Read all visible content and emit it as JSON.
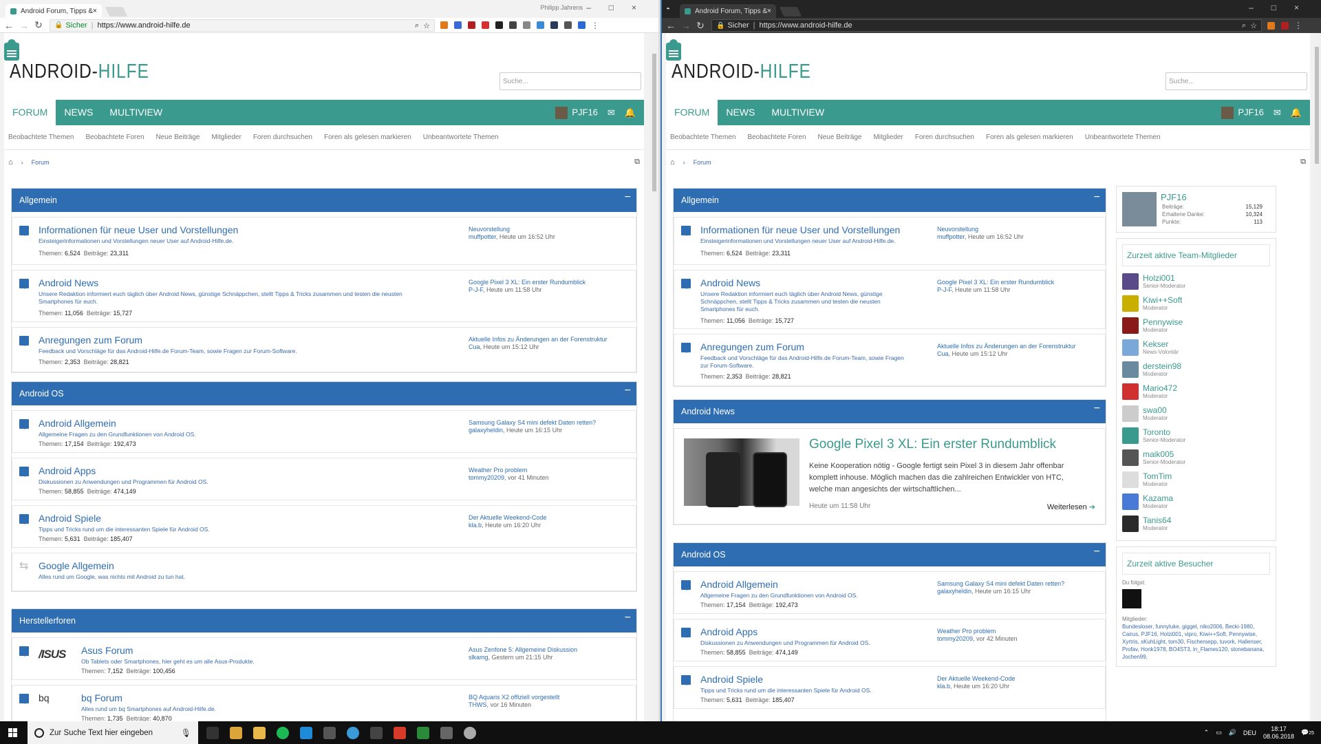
{
  "browser": {
    "tab_title": "Android Forum, Tipps &",
    "url": "https://www.android-hilfe.de",
    "secure_label": "Sicher",
    "profile_name": "Philipp Jahrens"
  },
  "site": {
    "logo_part1": "ANDROID-",
    "logo_part2": "HILFE",
    "search_placeholder": "Suche...",
    "nav": [
      "FORUM",
      "NEWS",
      "MULTIVIEW"
    ],
    "username": "PJF16",
    "subnav": [
      "Beobachtete Themen",
      "Beobachtete Foren",
      "Neue Beiträge",
      "Mitglieder",
      "Foren durchsuchen",
      "Foren als gelesen markieren",
      "Unbeantwortete Themen"
    ],
    "breadcrumb": "Forum"
  },
  "labels": {
    "threads": "Themen:",
    "posts": "Beiträge:",
    "collapse": "−"
  },
  "categories": {
    "allgemein": {
      "title": "Allgemein",
      "nodes": [
        {
          "title": "Informationen für neue User und Vorstellungen",
          "desc": "Einsteigerinformationen und Vorstellungen neuer User auf Android-Hilfe.de.",
          "threads": "6,524",
          "posts": "23,311",
          "last_title": "Neuvorstellung",
          "last_user": "muffpotter",
          "last_time": ", Heute um 16:52 Uhr"
        },
        {
          "title": "Android News",
          "desc": "Unsere Redaktion informiert euch täglich über Android News, günstige Schnäppchen, stellt Tipps & Tricks zusammen und testen die neusten Smartphones für euch.",
          "threads": "11,056",
          "posts": "15,727",
          "last_title": "Google Pixel 3 XL: Ein erster Rundumblick",
          "last_user": "P-J-F",
          "last_time": ", Heute um 11:58 Uhr"
        },
        {
          "title": "Anregungen zum Forum",
          "desc": "Feedback und Vorschläge für das Android-Hilfe.de Forum-Team, sowie Fragen zur Forum-Software.",
          "threads": "2,353",
          "posts": "28,821",
          "last_title": "Aktuelle Infos zu Änderungen an der Forenstruktur",
          "last_user": "Cua",
          "last_time": ", Heute um 15:12 Uhr"
        }
      ]
    },
    "android_os": {
      "title": "Android OS",
      "nodes": [
        {
          "title": "Android Allgemein",
          "desc": "Allgemeine Fragen zu den Grundfunktionen von Android OS.",
          "threads": "17,154",
          "posts": "192,473",
          "last_title": "Samsung Galaxy S4 mini defekt Daten retten?",
          "last_user": "galaxyheldin",
          "last_time": ", Heute um 16:15 Uhr"
        },
        {
          "title": "Android Apps",
          "desc": "Diskussionen zu Anwendungen und Programmen für Android OS.",
          "threads": "58,855",
          "posts": "474,149",
          "last_title": "Weather Pro problem",
          "last_user": "tommy20209",
          "last_time": ", vor 41 Minuten",
          "last_time2": ", vor 42 Minuten"
        },
        {
          "title": "Android Spiele",
          "desc": "Tipps und Tricks rund um die interessanten Spiele für Android OS.",
          "threads": "5,631",
          "posts": "185,407",
          "last_title": "Der Aktuelle Weekend-Code",
          "last_user": "kla.b",
          "last_time": ", Heute um 16:20 Uhr"
        },
        {
          "title": "Google Allgemein",
          "desc": "Alles rund um Google, was nichts mit Android zu tun hat."
        }
      ]
    },
    "hersteller": {
      "title": "Herstellerforen",
      "nodes": [
        {
          "title": "Asus Forum",
          "logo": "/ISUS",
          "desc": "Ob Tablets oder Smartphones, hier geht es um alle Asus-Produkte.",
          "threads": "7,152",
          "posts": "100,456",
          "last_title": "Asus Zenfone 5: Allgemeine Diskussion",
          "last_user": "slkamg",
          "last_time": ", Gestern um 21:15 Uhr"
        },
        {
          "title": "bq Forum",
          "logo": "bq",
          "desc": "Alles rund um bq Smartphones auf Android-Hilfe.de.",
          "threads": "1,735",
          "posts": "40,870",
          "last_title": "BQ Aquaris X2 offiziell vorgestellt",
          "last_user": "THWS",
          "last_time": ", vor 16 Minuten"
        }
      ]
    },
    "android_news": {
      "title": "Android News",
      "article_title": "Google Pixel 3 XL: Ein erster Rundumblick",
      "article_body": "Keine Kooperation nötig - Google fertigt sein Pixel 3 in diesem Jahr offenbar komplett inhouse. Möglich machen das die zahlreichen Entwickler von HTC, welche man angesichts der wirtschaftlichen...",
      "article_date": "Heute um 11:58 Uhr",
      "read_more": "Weiterlesen"
    }
  },
  "sidebar": {
    "profile": {
      "name": "PJF16",
      "rows": [
        [
          "Beiträge:",
          "15,129"
        ],
        [
          "Erhaltene Danke:",
          "10,324"
        ],
        [
          "Punkte:",
          "113"
        ]
      ]
    },
    "team_title": "Zurzeit aktive Team-Mitglieder",
    "team": [
      {
        "name": "Holzi001",
        "role": "Senior-Moderator",
        "color": "#5a4a8a"
      },
      {
        "name": "Kiwi++Soft",
        "role": "Moderator",
        "color": "#c9b000"
      },
      {
        "name": "Pennywise",
        "role": "Moderator",
        "color": "#8a1a1a"
      },
      {
        "name": "Kekser",
        "role": "News-Volontär",
        "color": "#7aa8d8"
      },
      {
        "name": "derstein98",
        "role": "Moderator",
        "color": "#6a8aa0"
      },
      {
        "name": "Mario472",
        "role": "Moderator",
        "color": "#d03030"
      },
      {
        "name": "swa00",
        "role": "Moderator",
        "color": "#cccccc"
      },
      {
        "name": "Toronto",
        "role": "Senior-Moderator",
        "color": "#3a9a8e"
      },
      {
        "name": "maik005",
        "role": "Senior-Moderator",
        "color": "#555555"
      },
      {
        "name": "TomTim",
        "role": "Moderator",
        "color": "#dddddd"
      },
      {
        "name": "Kazama",
        "role": "Moderator",
        "color": "#4a7ad8"
      },
      {
        "name": "Tanis64",
        "role": "Moderator",
        "color": "#2a2a2a"
      }
    ],
    "visitors_title": "Zurzeit aktive Besucher",
    "you_follow": "Du folgst:",
    "members_label": "Mitglieder:",
    "members": "Bundesloser, funnyluke, giggel, niko2006, Becki-1980, Cairus, PJF16, Holzi001, vipro, Kiwi++Soft, Pennywise, Xyrtris, sKuhLight, tom30, Fischersepp, tuvork, Hallenser, Profav, Honk1978, BO4ST3, in_Flames120, stonebanana, Jochen99,"
  },
  "taskbar": {
    "search_placeholder": "Zur Suche Text hier eingeben",
    "time": "18:17",
    "date": "08.06.2018",
    "lang": "DEU",
    "notif": "25"
  }
}
